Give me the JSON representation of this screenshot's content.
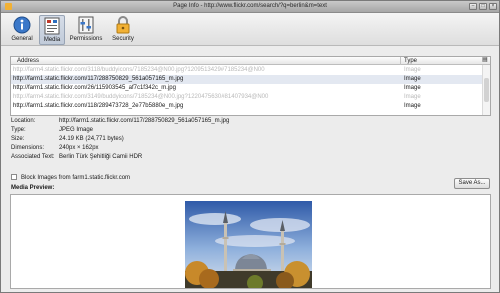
{
  "window": {
    "title": "Page Info - http://www.flickr.com/search/?q=berlin&m=text"
  },
  "toolbar": {
    "tabs": [
      {
        "label": "General",
        "icon": "info-icon"
      },
      {
        "label": "Media",
        "icon": "media-icon"
      },
      {
        "label": "Permissions",
        "icon": "permissions-icon"
      },
      {
        "label": "Security",
        "icon": "lock-icon"
      }
    ],
    "selected": "Media"
  },
  "media_table": {
    "columns": [
      "Address",
      "Type"
    ],
    "rows": [
      {
        "address": "http://farm4.static.flickr.com/3118/buddyicons/7185234@N00.jpg?1209513429#7185234@N00",
        "type": "Image",
        "dim": true
      },
      {
        "address": "http://farm1.static.flickr.com/117/288750829_561a057165_m.jpg",
        "type": "Image",
        "dim": false,
        "selected": true
      },
      {
        "address": "http://farm1.static.flickr.com/26/115903545_af7c1f342c_m.jpg",
        "type": "Image",
        "dim": false
      },
      {
        "address": "http://farm4.static.flickr.com/3149/buddyicons/7185234@N00.jpg?1220475630#81407934@N00",
        "type": "Image",
        "dim": true
      },
      {
        "address": "http://farm1.static.flickr.com/118/289473728_2e77b5880e_m.jpg",
        "type": "Image",
        "dim": false
      }
    ]
  },
  "details": {
    "location_label": "Location:",
    "location": "http://farm1.static.flickr.com/117/288750829_561a057165_m.jpg",
    "type_label": "Type:",
    "type": "JPEG Image",
    "size_label": "Size:",
    "size": "24.19 KB (24,771 bytes)",
    "dimensions_label": "Dimensions:",
    "dimensions": "240px × 162px",
    "alt_label": "Associated Text:",
    "alt": "Berlin Türk Şehitliği Camii HDR"
  },
  "block_images": "Block Images from farm1.static.flickr.com",
  "save_as": "Save As...",
  "preview_label": "Media Preview:"
}
